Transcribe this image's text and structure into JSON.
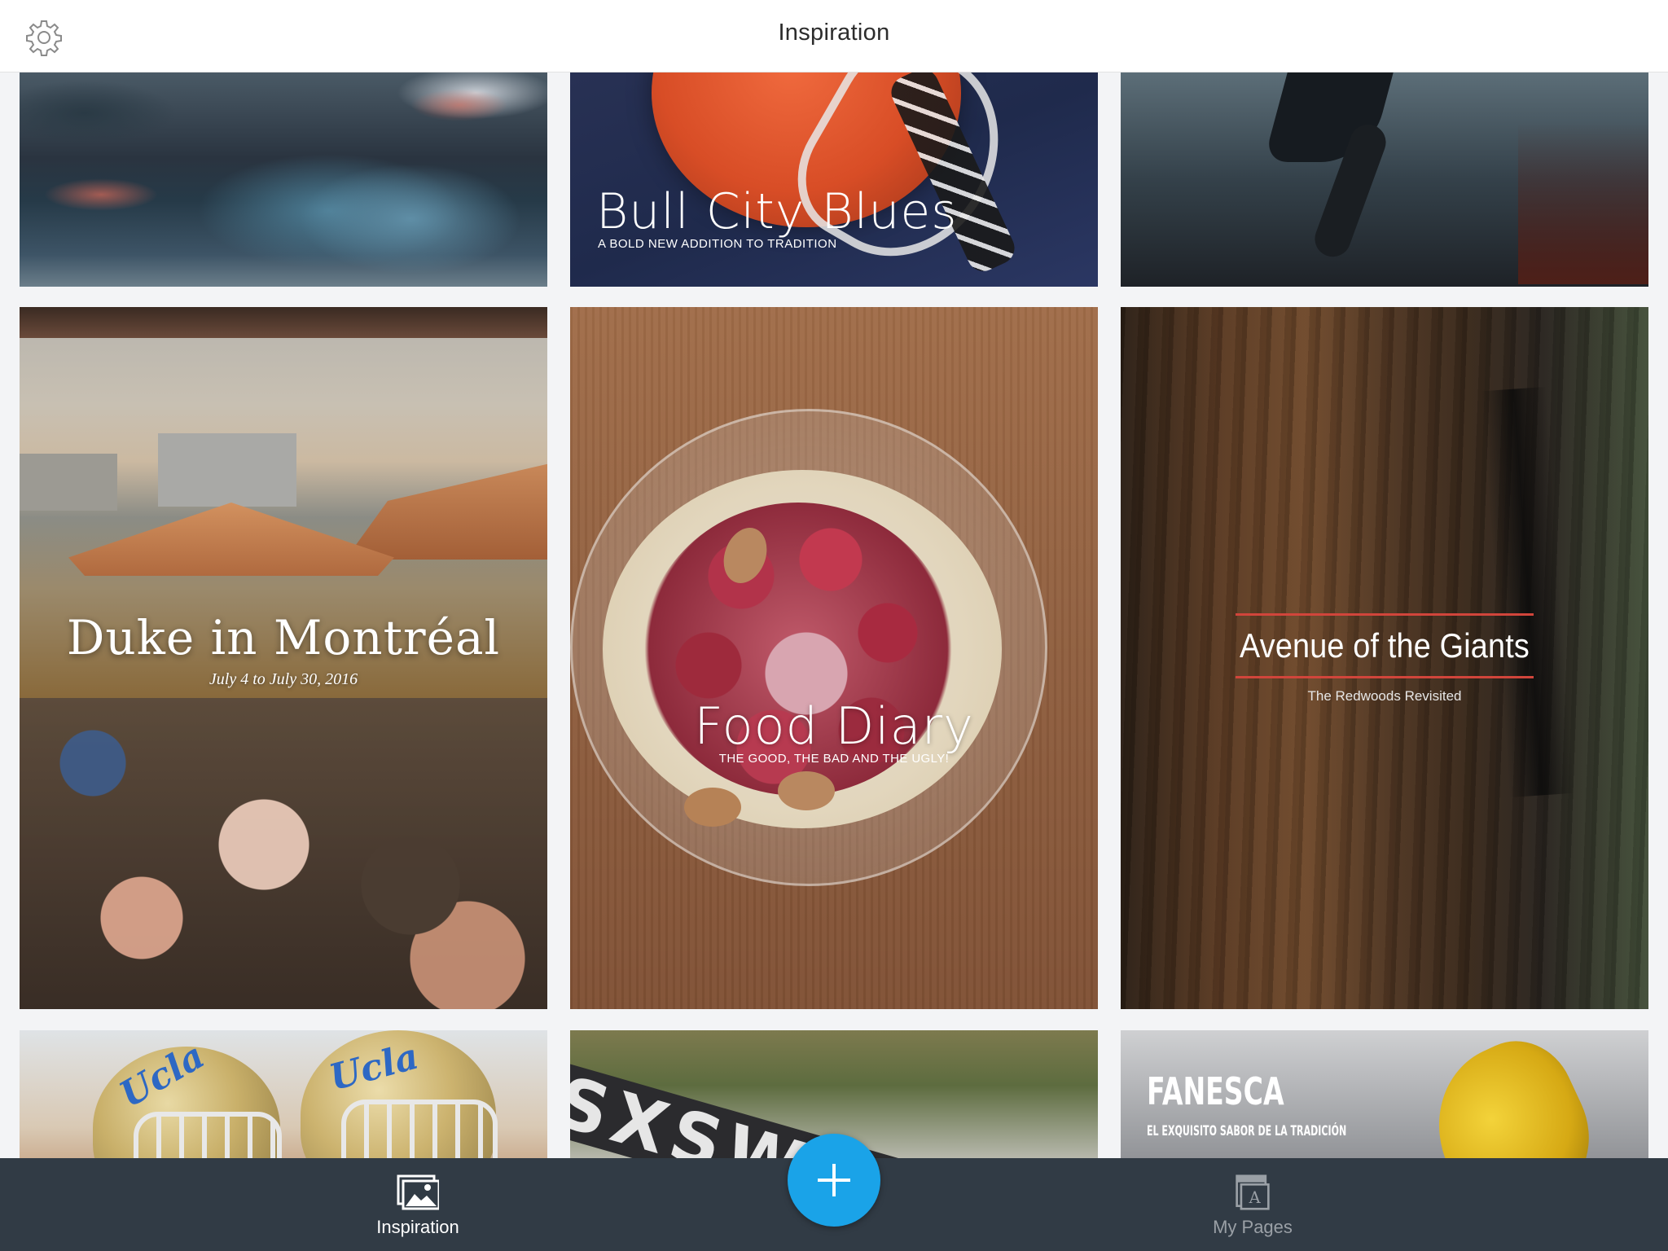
{
  "header": {
    "title": "Inspiration",
    "settings_icon": "gear-icon"
  },
  "cards": {
    "glacier": {},
    "bull_city": {
      "title": "Bull City Blues",
      "subtitle": "A BOLD NEW ADDITION TO TRADITION"
    },
    "surfer": {},
    "montreal": {
      "title": "Duke in Montréal",
      "subtitle": "July 4 to July 30, 2016"
    },
    "food_diary": {
      "title": "Food Diary",
      "subtitle": "THE GOOD, THE BAD AND THE UGLY!"
    },
    "giants": {
      "title": "Avenue of the Giants",
      "subtitle": "The Redwoods Revisited",
      "accent_color": "#d1453b"
    },
    "ucla": {
      "helmet_logo_left": "Ucla",
      "helmet_logo_right": "Ucla"
    },
    "sxsw": {
      "banner_text": "SXSW"
    },
    "fanesca": {
      "title": "FANESCA",
      "subtitle": "EL EXQUISITO SABOR DE LA TRADICIÓN"
    }
  },
  "tabbar": {
    "inspiration": {
      "label": "Inspiration",
      "icon": "image-gallery-icon",
      "selected": true
    },
    "my_pages": {
      "label": "My Pages",
      "icon": "pages-icon",
      "selected": false
    },
    "add_button": {
      "icon": "plus-icon",
      "color": "#1aa3e8"
    },
    "background": "#313b45"
  }
}
